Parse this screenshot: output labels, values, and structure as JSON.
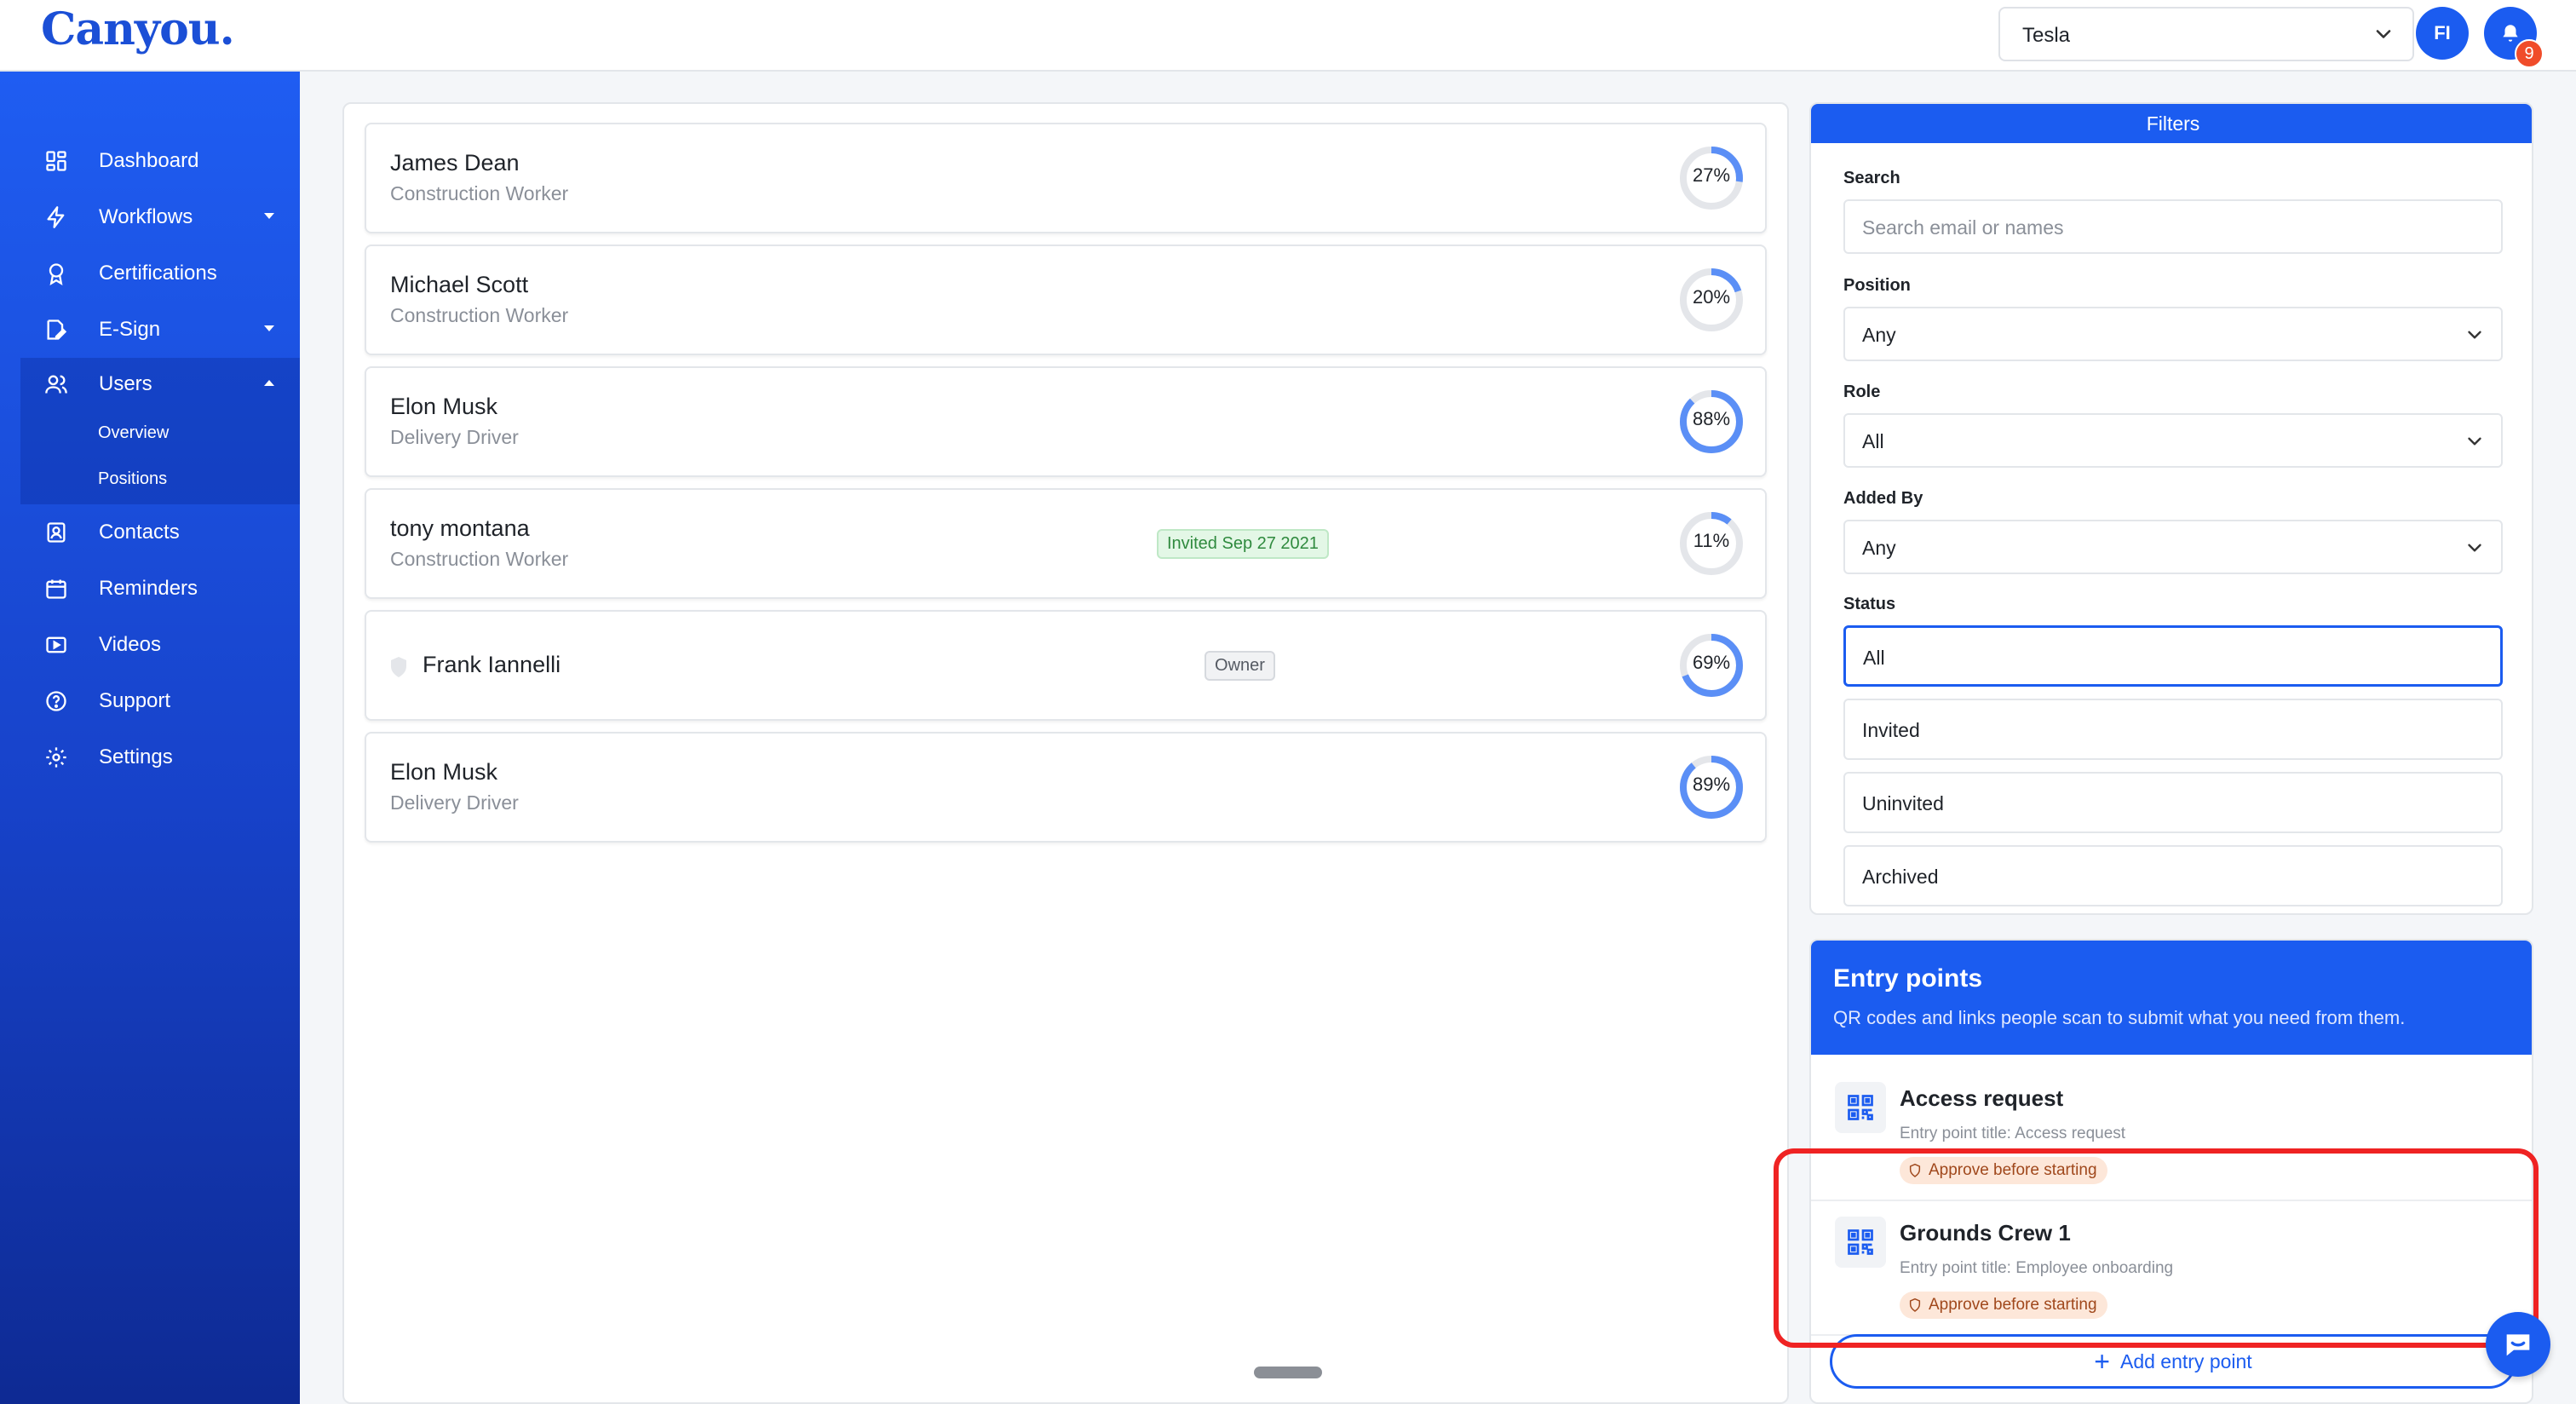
{
  "brand": {
    "logo_text": "Canyou."
  },
  "header": {
    "company_select": {
      "value": "Tesla"
    },
    "avatar_initials": "FI",
    "notification_count": "9"
  },
  "sidebar": {
    "items": [
      {
        "label": "Dashboard",
        "icon": "dashboard-icon"
      },
      {
        "label": "Workflows",
        "icon": "bolt-icon"
      },
      {
        "label": "Certifications",
        "icon": "award-icon"
      },
      {
        "label": "E-Sign",
        "icon": "signature-icon"
      },
      {
        "label": "Users",
        "icon": "users-icon"
      },
      {
        "label": "Contacts",
        "icon": "contacts-icon"
      },
      {
        "label": "Reminders",
        "icon": "calendar-icon"
      },
      {
        "label": "Videos",
        "icon": "video-icon"
      },
      {
        "label": "Support",
        "icon": "help-icon"
      },
      {
        "label": "Settings",
        "icon": "gear-icon"
      }
    ],
    "users_sub": [
      "Overview",
      "Positions"
    ]
  },
  "users": [
    {
      "name": "James Dean",
      "role": "Construction Worker",
      "progress": 27,
      "progress_label": "27%"
    },
    {
      "name": "Michael Scott",
      "role": "Construction Worker",
      "progress": 20,
      "progress_label": "20%"
    },
    {
      "name": "Elon Musk",
      "role": "Delivery Driver",
      "progress": 88,
      "progress_label": "88%"
    },
    {
      "name": "tony montana",
      "role": "Construction Worker",
      "progress": 11,
      "progress_label": "11%",
      "badge": "Invited Sep 27 2021"
    },
    {
      "name": "Frank Iannelli",
      "role": "",
      "progress": 69,
      "progress_label": "69%",
      "badge": "Owner"
    },
    {
      "name": "Elon Musk",
      "role": "Delivery Driver",
      "progress": 89,
      "progress_label": "89%"
    }
  ],
  "filters": {
    "title": "Filters",
    "search_label": "Search",
    "search_placeholder": "Search email or names",
    "position_label": "Position",
    "position_value": "Any",
    "role_label": "Role",
    "role_value": "All",
    "added_by_label": "Added By",
    "added_by_value": "Any",
    "status_label": "Status",
    "status_options": [
      "All",
      "Invited",
      "Uninvited",
      "Archived"
    ],
    "status_selected": "All"
  },
  "entry_points": {
    "title": "Entry points",
    "subtitle": "QR codes and links people scan to submit what you need from them.",
    "items": [
      {
        "name": "Access request",
        "subtitle": "Entry point title: Access request",
        "tag": "Approve before starting"
      },
      {
        "name": "Grounds Crew 1",
        "subtitle": "Entry point title: Employee onboarding",
        "tag": "Approve before starting"
      }
    ],
    "add_label": "Add entry point"
  },
  "colors": {
    "primary": "#1b5cf0",
    "ring_track": "#e4e6ea",
    "ring_fill": "#5b8ff6",
    "highlight": "#ef2323"
  }
}
